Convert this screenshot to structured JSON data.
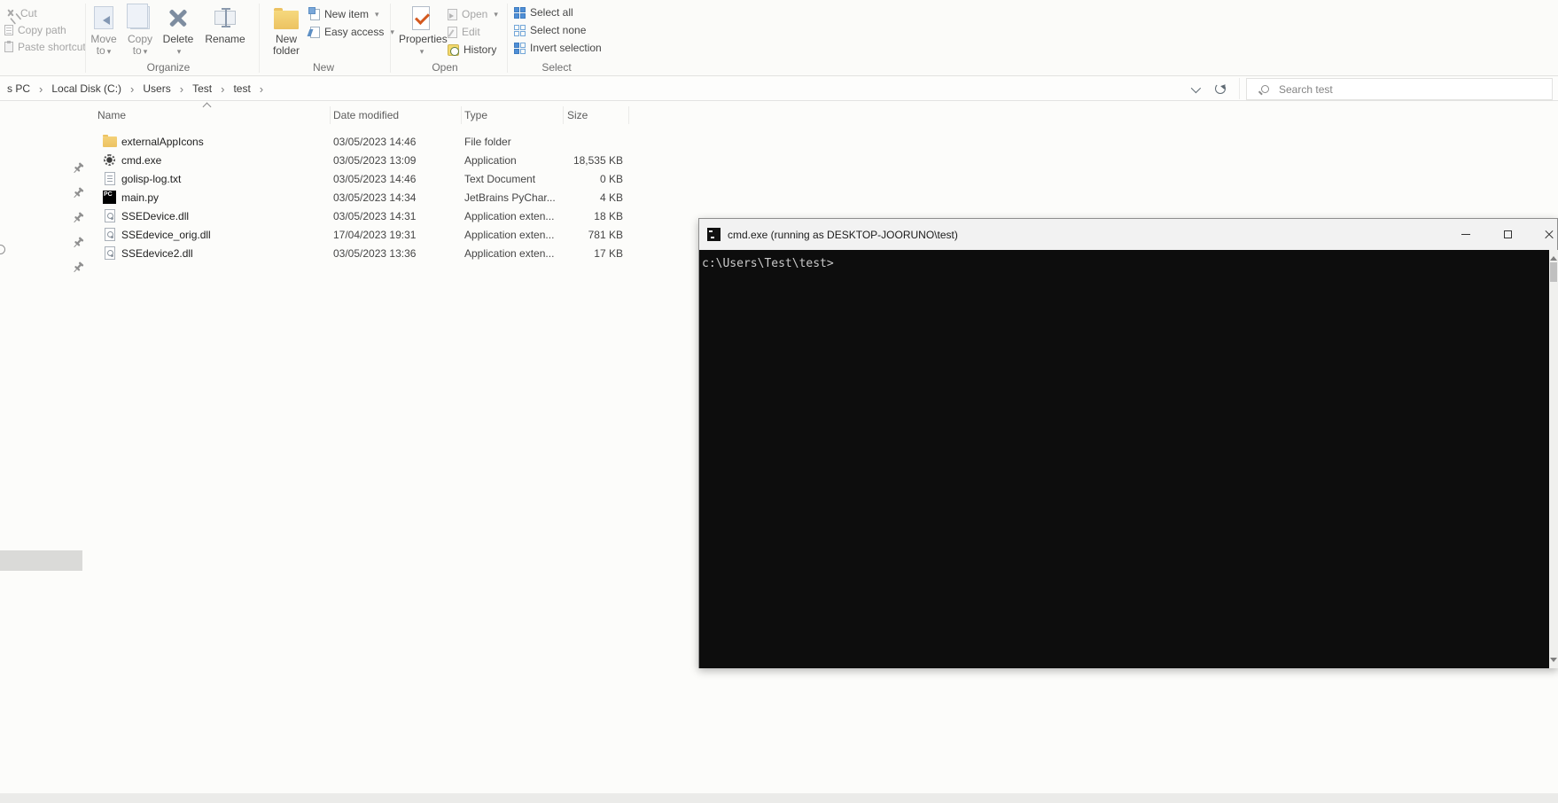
{
  "ribbon": {
    "clipboard": {
      "cut": "Cut",
      "copy_path": "Copy path",
      "paste_shortcut": "Paste shortcut"
    },
    "organize": {
      "label": "Organize",
      "move_line1": "Move",
      "move_line2": "to",
      "copy_line1": "Copy",
      "copy_line2": "to",
      "delete": "Delete",
      "rename": "Rename",
      "dropdown_glyph": "▾"
    },
    "new_group": {
      "label": "New",
      "new_folder_line1": "New",
      "new_folder_line2": "folder",
      "new_item": "New item",
      "easy_access": "Easy access"
    },
    "open_group": {
      "label": "Open",
      "properties": "Properties",
      "open": "Open",
      "edit": "Edit",
      "history": "History"
    },
    "select_group": {
      "label": "Select",
      "select_all": "Select all",
      "select_none": "Select none",
      "invert_selection": "Invert selection"
    }
  },
  "address_bar": {
    "breadcrumb": [
      "s PC",
      "Local Disk (C:)",
      "Users",
      "Test",
      "test"
    ],
    "separator": "›",
    "search_placeholder": "Search test"
  },
  "file_list": {
    "columns": [
      "Name",
      "Date modified",
      "Type",
      "Size"
    ],
    "rows": [
      {
        "name": "externalAppIcons",
        "date": "03/05/2023 14:46",
        "type": "File folder",
        "size": "",
        "icon": "folder"
      },
      {
        "name": "cmd.exe",
        "date": "03/05/2023 13:09",
        "type": "Application",
        "size": "18,535 KB",
        "icon": "gear"
      },
      {
        "name": "golisp-log.txt",
        "date": "03/05/2023 14:46",
        "type": "Text Document",
        "size": "0 KB",
        "icon": "text"
      },
      {
        "name": "main.py",
        "date": "03/05/2023 14:34",
        "type": "JetBrains PyChar...",
        "size": "4 KB",
        "icon": "pycharm"
      },
      {
        "name": "SSEDevice.dll",
        "date": "03/05/2023 14:31",
        "type": "Application exten...",
        "size": "18 KB",
        "icon": "dll"
      },
      {
        "name": "SSEdevice_orig.dll",
        "date": "17/04/2023 19:31",
        "type": "Application exten...",
        "size": "781 KB",
        "icon": "dll"
      },
      {
        "name": "SSEdevice2.dll",
        "date": "03/05/2023 13:36",
        "type": "Application exten...",
        "size": "17 KB",
        "icon": "dll"
      }
    ]
  },
  "icons": {
    "pycharm_badge": "PC"
  },
  "cmd_window": {
    "title": "cmd.exe (running as DESKTOP-JOORUNO\\test)",
    "prompt": "c:\\Users\\Test\\test>"
  }
}
